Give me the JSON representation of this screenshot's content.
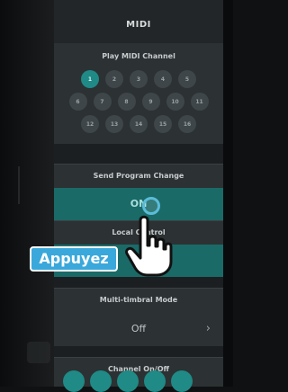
{
  "screen": {
    "title": "MIDI"
  },
  "play_midi_channel": {
    "label": "Play MIDI Channel",
    "rows": [
      [
        "1",
        "2",
        "3",
        "4",
        "5"
      ],
      [
        "6",
        "7",
        "8",
        "9",
        "10",
        "11"
      ],
      [
        "12",
        "13",
        "14",
        "15",
        "16"
      ]
    ],
    "selected": "1"
  },
  "send_program_change": {
    "label": "Send Program Change",
    "value": "ON"
  },
  "local_control": {
    "label": "Local Control",
    "value": ""
  },
  "multi_timbral_mode": {
    "label": "Multi-timbral Mode",
    "value": "Off",
    "chevron": "›"
  },
  "channel_on_off": {
    "label": "Channel On/Off"
  },
  "overlay": {
    "tap_label": "Appuyez",
    "hand_icon": "pointing-hand-icon"
  },
  "colors": {
    "accent": "#1f8a86",
    "badge": "#3aa8db",
    "panel": "#222628"
  }
}
